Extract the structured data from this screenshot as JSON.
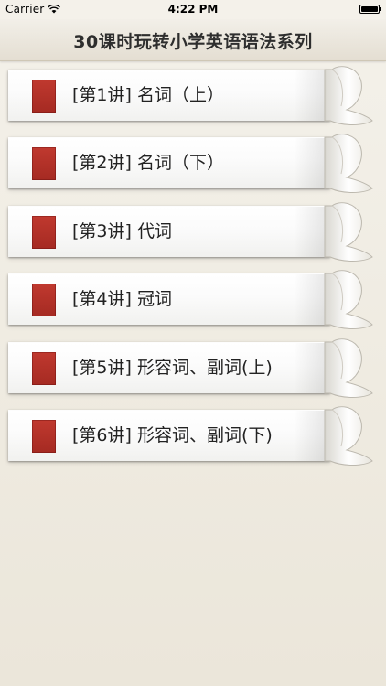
{
  "status_bar": {
    "carrier": "Carrier",
    "time": "4:22 PM",
    "wifi_icon": "wifi-icon",
    "battery_icon": "battery-icon"
  },
  "nav": {
    "title": "30课时玩转小学英语语法系列"
  },
  "lessons": [
    {
      "label": "[第1讲] 名词（上）"
    },
    {
      "label": "[第2讲] 名词（下）"
    },
    {
      "label": "[第3讲] 代词"
    },
    {
      "label": "[第4讲] 冠词"
    },
    {
      "label": "[第5讲] 形容词、副词(上)"
    },
    {
      "label": "[第6讲] 形容词、副词(下)"
    }
  ],
  "colors": {
    "bookmark": "#b3342a",
    "background": "#f1ede4",
    "nav_title": "#2e2e2e"
  }
}
